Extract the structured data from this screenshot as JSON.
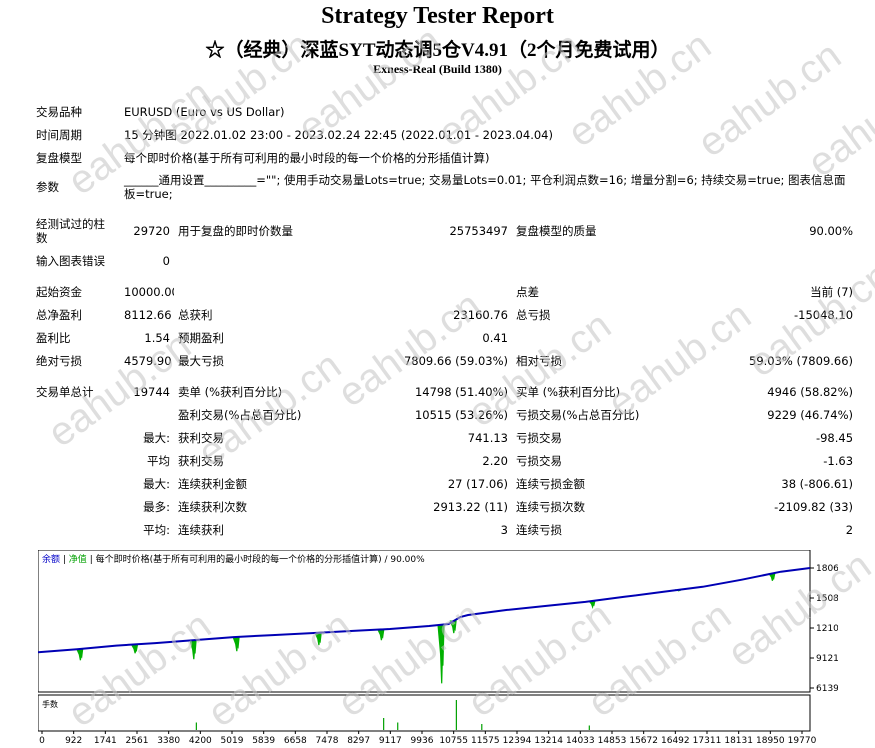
{
  "header": {
    "title": "Strategy Tester Report",
    "subtitle": "☆（经典）深蓝SYT动态调5仓V4.91（2个月免费试用）",
    "server": "Exness-Real (Build 1380)"
  },
  "info": {
    "symbol_label": "交易品种",
    "symbol": "EURUSD (Euro vs US Dollar)",
    "period_label": "时间周期",
    "period": "15 分钟图 2022.01.02 23:00 - 2023.02.24 22:45 (2022.01.01 - 2023.04.04)",
    "model_label": "复盘模型",
    "model": "每个即时价格(基于所有可利用的最小时段的每一个价格的分形插值计算)",
    "params_label": "参数",
    "params": "______通用设置_________=\"\"; 使用手动交易量Lots=true; 交易量Lots=0.01; 平仓利润点数=16; 增量分割=6; 持续交易=true; 图表信息面板=true;"
  },
  "stats": {
    "bars_label": "经测试过的柱数",
    "bars": "29720",
    "ticks_label": "用于复盘的即时价数量",
    "ticks": "25753497",
    "quality_label": "复盘模型的质量",
    "quality": "90.00%",
    "errors_label": "输入图表错误",
    "errors": "0",
    "deposit_label": "起始资金",
    "deposit": "10000.00",
    "spread_label": "点差",
    "spread": "当前 (7)",
    "net_label": "总净盈利",
    "net": "8112.66",
    "gross_profit_label": "总获利",
    "gross_profit": "23160.76",
    "gross_loss_label": "总亏损",
    "gross_loss": "-15048.10",
    "pf_label": "盈利比",
    "pf": "1.54",
    "payoff_label": "预期盈利",
    "payoff": "0.41",
    "abs_dd_label": "绝对亏损",
    "abs_dd": "4579.90",
    "max_dd_label": "最大亏损",
    "max_dd": "7809.66 (59.03%)",
    "rel_dd_label": "相对亏损",
    "rel_dd": "59.03% (7809.66)",
    "trades_label": "交易单总计",
    "trades": "19744",
    "short_label": "卖单 (%获利百分比)",
    "short": "14798 (51.40%)",
    "long_label": "买单 (%获利百分比)",
    "long": "4946 (58.82%)",
    "win_label": "盈利交易(%占总百分比)",
    "win": "10515 (53.26%)",
    "loss_label": "亏损交易(%占总百分比)",
    "loss": "9229 (46.74%)",
    "max_label": "最大:",
    "largest_win_label": "获利交易",
    "largest_win": "741.13",
    "largest_loss_label": "亏损交易",
    "largest_loss": "-98.45",
    "avg_label": "平均",
    "avg_win_label": "获利交易",
    "avg_win": "2.20",
    "avg_loss_label": "亏损交易",
    "avg_loss": "-1.63",
    "max2_label": "最大:",
    "cons_win_amt_label": "连续获利金额",
    "cons_win_amt": "27 (17.06)",
    "cons_loss_amt_label": "连续亏损金额",
    "cons_loss_amt": "38 (-806.61)",
    "most_label": "最多:",
    "cons_win_cnt_label": "连续获利次数",
    "cons_win_cnt": "2913.22 (11)",
    "cons_loss_cnt_label": "连续亏损次数",
    "cons_loss_cnt": "-2109.82 (33)",
    "avg2_label": "平均:",
    "avg_cons_win_label": "连续获利",
    "avg_cons_win": "3",
    "avg_cons_loss_label": "连续亏损",
    "avg_cons_loss": "2"
  },
  "watermark": "eahub.cn",
  "chart_data": {
    "type": "line",
    "legend_balance": "余额",
    "legend_equity": "净值",
    "legend_text": "每个即时价格(基于所有可利用的最小时段的每一个价格的分形插值计算) / 90.00%",
    "volume_label": "手数",
    "y_ticks": [
      "18067",
      "15085",
      "12103",
      "9121",
      "6139"
    ],
    "y_tick_values": [
      18067,
      15085,
      12103,
      9121,
      6139
    ],
    "ylim": [
      6139,
      18067
    ],
    "x_ticks": [
      "0",
      "922",
      "1741",
      "2561",
      "3380",
      "4200",
      "5019",
      "5839",
      "6658",
      "7478",
      "8297",
      "9117",
      "9936",
      "10755",
      "11575",
      "12394",
      "13214",
      "14033",
      "14853",
      "15672",
      "16492",
      "17311",
      "18131",
      "18950",
      "19770"
    ],
    "xlim": [
      0,
      19744
    ],
    "balance": {
      "x": [
        0,
        1000,
        2000,
        3000,
        4000,
        5000,
        6000,
        7000,
        8000,
        9000,
        10000,
        10500,
        10800,
        11000,
        12000,
        13000,
        14000,
        15000,
        16000,
        17000,
        18000,
        18500,
        19000,
        19744
      ],
      "y": [
        9700,
        10000,
        10350,
        10600,
        10900,
        11200,
        11400,
        11600,
        11800,
        12000,
        12300,
        12500,
        13200,
        13400,
        13900,
        14300,
        14700,
        15200,
        15700,
        16200,
        16900,
        17300,
        17700,
        18067
      ]
    },
    "equity_drops": [
      {
        "x": 1100,
        "y": 8900
      },
      {
        "x": 2500,
        "y": 9600
      },
      {
        "x": 4000,
        "y": 9000
      },
      {
        "x": 5100,
        "y": 9800
      },
      {
        "x": 7200,
        "y": 10400
      },
      {
        "x": 8800,
        "y": 10900
      },
      {
        "x": 10340,
        "y": 6600
      },
      {
        "x": 10650,
        "y": 11600
      },
      {
        "x": 14200,
        "y": 14200
      },
      {
        "x": 16400,
        "y": 15800
      },
      {
        "x": 18800,
        "y": 16800
      }
    ],
    "volume_spikes": [
      {
        "x": 8840,
        "v": 0.4
      },
      {
        "x": 9200,
        "v": 0.25
      },
      {
        "x": 10700,
        "v": 1.0
      },
      {
        "x": 11350,
        "v": 0.2
      },
      {
        "x": 4050,
        "v": 0.25
      },
      {
        "x": 14100,
        "v": 0.15
      }
    ]
  }
}
